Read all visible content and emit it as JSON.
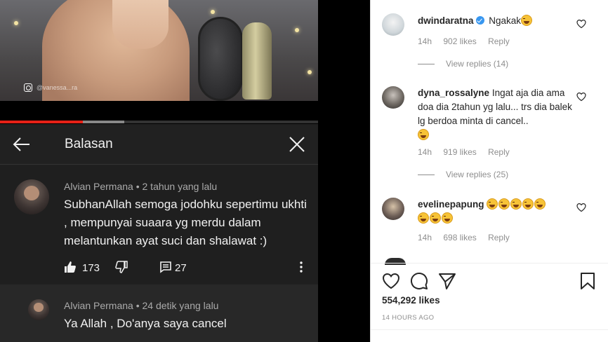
{
  "youtube": {
    "watermark_icon": "instagram-icon",
    "watermark_text": "@vanessa...ra",
    "progress": {
      "played": 0.26,
      "buffered_start": 0.26,
      "buffered_end": 0.39
    },
    "panel_title": "Balasan",
    "main_comment": {
      "author_meta": "Alvian Permana • 2 tahun yang lalu",
      "text": "SubhanAllah semoga jodohku sepertimu ukhti , mempunyai suaara yg merdu dalam melantunkan ayat suci dan shalawat :)",
      "like_count": "173",
      "reply_count": "27"
    },
    "reply_comment": {
      "author_meta": "Alvian Permana • 24 detik yang lalu",
      "text": "Ya Allah , Do'anya saya cancel"
    },
    "colors": {
      "accent": "#e62117",
      "panel": "#202020"
    }
  },
  "instagram": {
    "comments": [
      {
        "username": "dwindaratna",
        "text": "Ngakak",
        "emoji_count": 1,
        "time": "14h",
        "likes": "902 likes",
        "reply_label": "Reply",
        "view_replies": "View replies (14)"
      },
      {
        "username": "dyna_rossalyne",
        "text": "Ingat aja dia ama doa dia 2tahun yg lalu... trs dia balek lg berdoa minta di cancel..",
        "emoji_count": 1,
        "time": "14h",
        "likes": "919 likes",
        "reply_label": "Reply",
        "view_replies": "View replies (25)"
      },
      {
        "username": "evelinepapung",
        "text": "",
        "emoji_count": 8,
        "time": "14h",
        "likes": "698 likes",
        "reply_label": "Reply"
      }
    ],
    "likes_total": "554,292 likes",
    "posted_time": "14 HOURS AGO",
    "colors": {
      "text": "#262626",
      "muted": "#8e8e8e",
      "verified": "#3897f0"
    }
  }
}
